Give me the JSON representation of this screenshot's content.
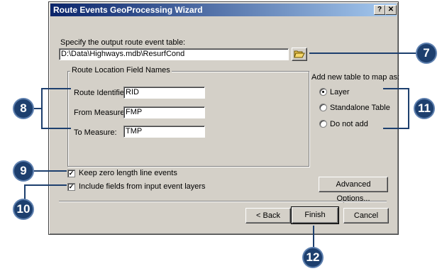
{
  "window": {
    "title": "Route Events GeoProcessing Wizard",
    "help_btn": "?",
    "close_btn": "✕"
  },
  "output": {
    "label": "Specify the output route event table:",
    "value": "D:\\Data\\Highways.mdb\\ResurfCond"
  },
  "fields_group": {
    "title": "Route Location Field Names",
    "route_id_label": "Route Identifier:",
    "route_id_value": "RID",
    "from_label": "From Measure:",
    "from_value": "FMP",
    "to_label": "To Measure:",
    "to_value": "TMP"
  },
  "add_table": {
    "label": "Add new table to map as:",
    "options": [
      "Layer",
      "Standalone Table",
      "Do not add"
    ],
    "selected": "Layer"
  },
  "checkboxes": {
    "keep_zero": "Keep zero length line events",
    "include_fields": "Include fields from input event layers"
  },
  "buttons": {
    "advanced": "Advanced Options...",
    "back": "< Back",
    "finish": "Finish",
    "cancel": "Cancel"
  },
  "callouts": [
    "7",
    "8",
    "9",
    "10",
    "11",
    "12"
  ]
}
